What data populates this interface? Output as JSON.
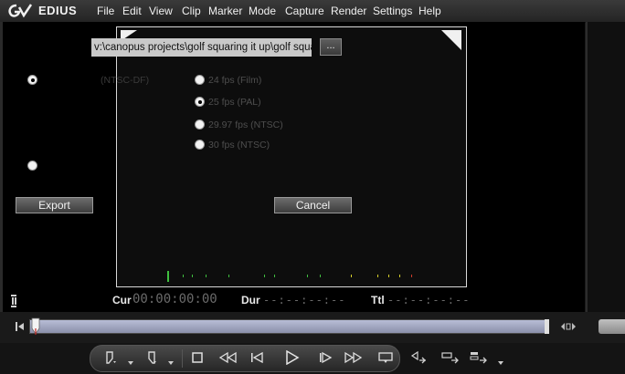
{
  "app": {
    "name": "EDIUS"
  },
  "menu": [
    "File",
    "Edit",
    "View",
    "Clip",
    "Marker",
    "Mode",
    "Capture",
    "Render",
    "Settings",
    "Help"
  ],
  "export": {
    "path": "v:\\canopus projects\\golf squaring it up\\golf squar",
    "browse_label": "...",
    "left_option_label": "(NTSC-DF)",
    "fps_options": [
      {
        "label": "24 fps (Film)",
        "checked": false
      },
      {
        "label": "25 fps (PAL)",
        "checked": true
      },
      {
        "label": "29.97 fps (NTSC)",
        "checked": false
      },
      {
        "label": "30 fps (NTSC)",
        "checked": false
      }
    ],
    "export_label": "Export",
    "cancel_label": "Cancel"
  },
  "timecode": {
    "cur_label": "Cur",
    "cur_value": "00:00:00:00",
    "dur_label": "Dur",
    "dur_value": "--:--:--:--",
    "ttl_label": "Ttl",
    "ttl_value": "--:--:--:--"
  },
  "colors": {
    "menubar": "#2f2f2f",
    "scrub": "#a3a8c2",
    "meter_green": "#3fbf3f",
    "meter_yellow": "#d6cf2a",
    "meter_red": "#d03a2a"
  }
}
